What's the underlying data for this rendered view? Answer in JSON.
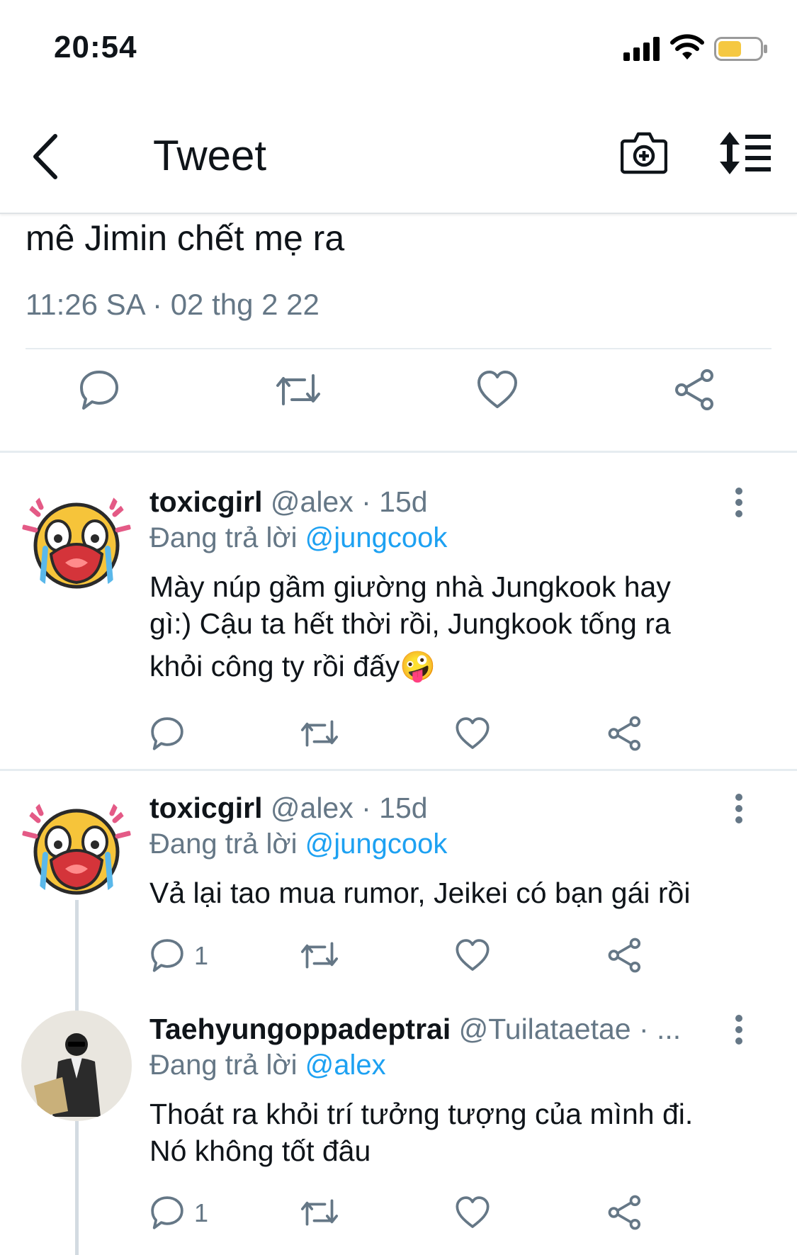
{
  "status": {
    "time": "20:54"
  },
  "nav": {
    "title": "Tweet"
  },
  "main_tweet": {
    "text_tail": "mê Jimin chết mẹ ra",
    "timestamp": "11:26 SA · 02 thg 2 22"
  },
  "replies": [
    {
      "name": "toxicgirl",
      "meta": "@alex · 15d",
      "reply_prefix": "Đang trả lời",
      "reply_to": "@jungcook",
      "text_lines": [
        "Mày núp gầm giường nhà Jungkook hay",
        "gì:) Cậu ta hết thời rồi, Jungkook tống ra",
        "khỏi công ty rồi đấy🤪"
      ],
      "reply_count": ""
    },
    {
      "name": "toxicgirl",
      "meta": "@alex · 15d",
      "reply_prefix": "Đang trả lời",
      "reply_to": "@jungcook",
      "text_lines": [
        "Vả lại tao mua rumor, Jeikei có bạn gái rồi"
      ],
      "reply_count": "1"
    },
    {
      "name": "Taehyungoppadeptrai",
      "meta": "@Tuilataetae · ...",
      "reply_prefix": "Đang trả lời",
      "reply_to": "@alex",
      "text_lines": [
        "Thoát ra khỏi trí tưởng tượng của mình đi.",
        "Nó không tốt đâu"
      ],
      "reply_count": "1"
    }
  ],
  "colors": {
    "accent": "#1da1f2",
    "secondary": "#657786",
    "battery": "#f5c842"
  }
}
